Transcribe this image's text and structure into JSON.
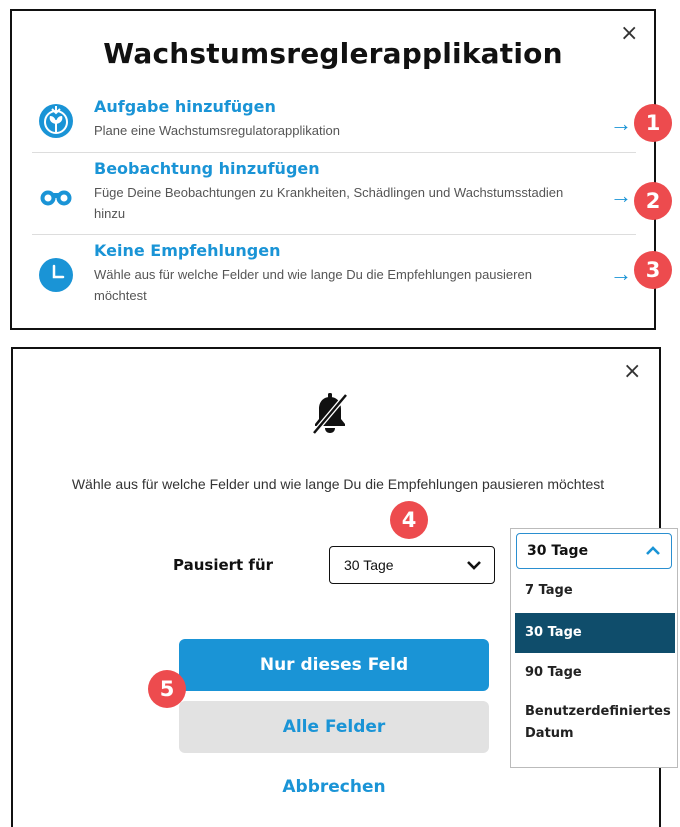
{
  "dialog1": {
    "title": "Wachstumsreglerapplikation",
    "close_label": "×",
    "items": [
      {
        "icon": "plant-icon",
        "title": "Aufgabe hinzufügen",
        "desc": "Plane eine Wachstumsregulatorapplikation",
        "arrow": "→",
        "badge": "1"
      },
      {
        "icon": "binoculars-icon",
        "title": "Beobachtung hinzufügen",
        "desc": "Füge Deine Beobachtungen zu Krankheiten, Schädlingen und Wachstumsstadien hinzu",
        "arrow": "→",
        "badge": "2"
      },
      {
        "icon": "clock-icon",
        "title": "Keine Empfehlungen",
        "desc": "Wähle aus für welche Felder und wie lange Du die Empfehlungen pausieren möchtest",
        "arrow": "→",
        "badge": "3"
      }
    ]
  },
  "dialog2": {
    "close_label": "×",
    "icon": "bell-off-icon",
    "description": "Wähle aus für welche Felder und wie lange Du die Empfehlungen pausieren möchtest",
    "badge_4": "4",
    "badge_5": "5",
    "paused_label": "Pausiert für",
    "select_value": "30 Tage",
    "dropdown": {
      "selected": "30 Tage",
      "options": [
        "7 Tage",
        "30 Tage",
        "90 Tage",
        "Benutzerdefiniertes Datum"
      ]
    },
    "btn_this_field": "Nur dieses Feld",
    "btn_all_fields": "Alle Felder",
    "cancel": "Abbrechen"
  },
  "colors": {
    "accent": "#1a94d6",
    "badge": "#ed4b4e",
    "selected_option": "#0f4d6b",
    "secondary_button": "#e2e2e2"
  }
}
